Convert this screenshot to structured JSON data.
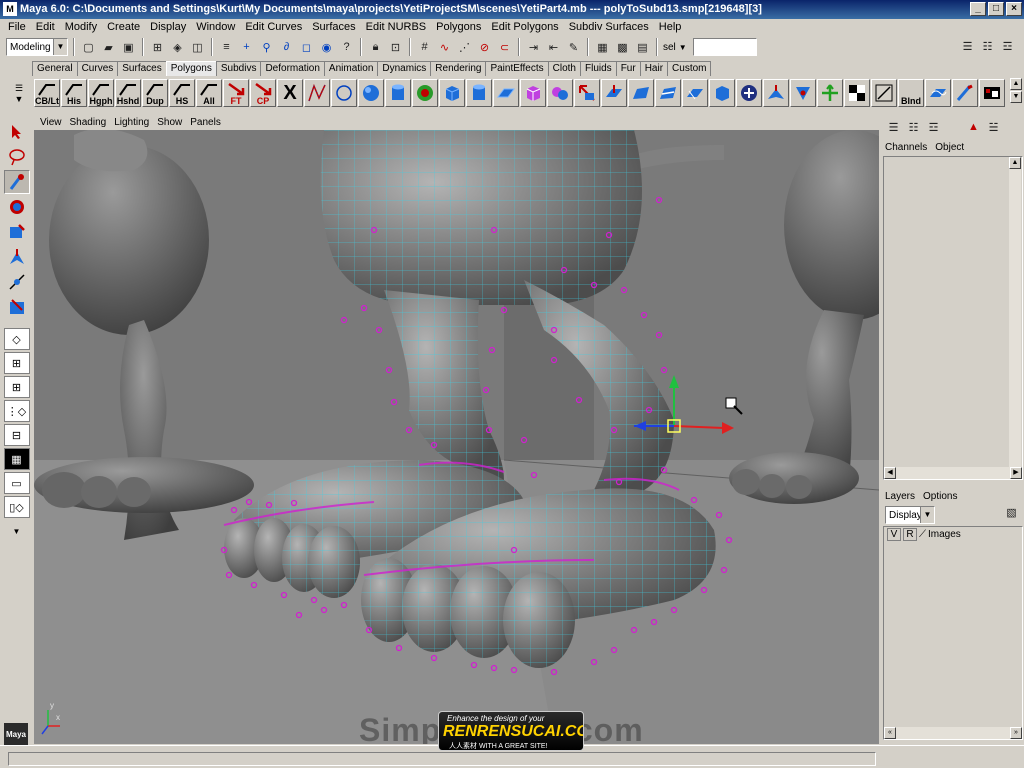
{
  "window": {
    "title": "Maya 6.0: C:\\Documents and Settings\\Kurt\\My Documents\\maya\\projects\\YetiProjectSM\\scenes\\YetiPart4.mb   ---   polyToSubd13.smp[219648][3]",
    "app_icon_label": "M"
  },
  "menubar": [
    "File",
    "Edit",
    "Modify",
    "Create",
    "Display",
    "Window",
    "Edit Curves",
    "Surfaces",
    "Edit NURBS",
    "Polygons",
    "Edit Polygons",
    "Subdiv Surfaces",
    "Help"
  ],
  "statusline": {
    "mode": "Modeling",
    "sel_label": "sel",
    "sel_value": ""
  },
  "shelf_tabs": [
    "General",
    "Curves",
    "Surfaces",
    "Polygons",
    "Subdivs",
    "Deformation",
    "Animation",
    "Dynamics",
    "Rendering",
    "PaintEffects",
    "Cloth",
    "Fluids",
    "Fur",
    "Hair",
    "Custom"
  ],
  "shelf_active_tab": "Polygons",
  "shelf_buttons": [
    {
      "label": "CB/Lt",
      "color": "#202020",
      "icon": "cb-icon"
    },
    {
      "label": "His",
      "color": "#202020",
      "icon": "history-icon"
    },
    {
      "label": "Hgph",
      "color": "#202020",
      "icon": "hypergraph-icon"
    },
    {
      "label": "Hshd",
      "color": "#202020",
      "icon": "hypershade-icon"
    },
    {
      "label": "Dup",
      "color": "#202020",
      "icon": "duplicate-icon"
    },
    {
      "label": "HS",
      "color": "#202020",
      "icon": "hide-selected-icon"
    },
    {
      "label": "All",
      "color": "#202020",
      "icon": "show-all-icon"
    },
    {
      "label": "FT",
      "color": "#c00000",
      "icon": "freeze-transforms-icon"
    },
    {
      "label": "CP",
      "color": "#c00000",
      "icon": "center-pivot-icon"
    }
  ],
  "shelf_end_label": "Blnd",
  "viewport": {
    "menu": [
      "View",
      "Shading",
      "Lighting",
      "Show",
      "Panels"
    ],
    "axis_x": "x",
    "axis_y": "y",
    "watermark": "SimpleWorld.com",
    "badge_line1": "Enhance the design of your",
    "badge_line2": "RENRENSUCAI.COM",
    "badge_line3": "人人素材  WITH A GREAT SITE!"
  },
  "channel_box": {
    "tabs": [
      "Channels",
      "Object"
    ]
  },
  "layer_editor": {
    "tabs": [
      "Layers",
      "Options"
    ],
    "display_select": "Display",
    "layers": [
      {
        "v": "V",
        "r": "R",
        "name": "Images"
      }
    ]
  },
  "colors": {
    "accent": "#0a246a",
    "wire": "#3cd0e6",
    "vertex": "#d020d0",
    "viewport_bg": "#5a5a5a"
  }
}
